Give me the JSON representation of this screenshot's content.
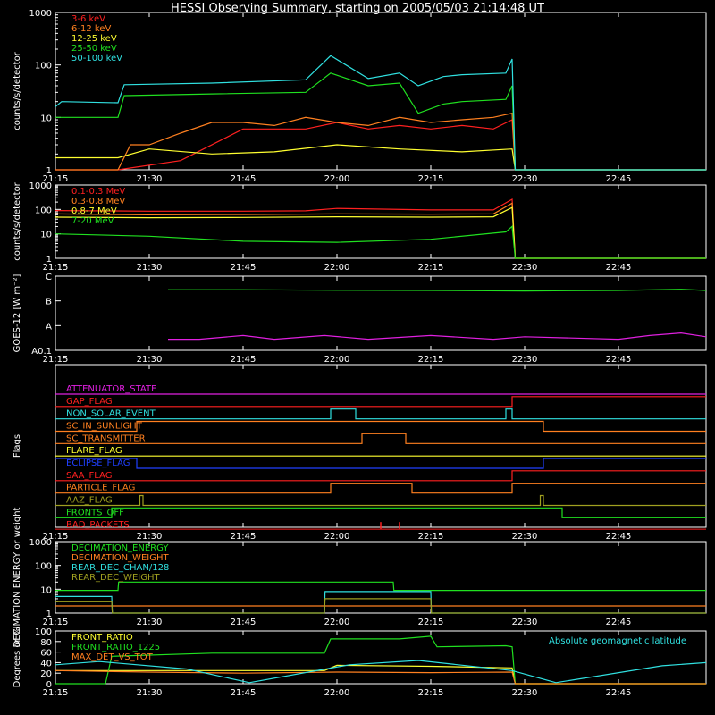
{
  "title": "HESSI Observing Summary, starting on 2005/05/03 21:14:48 UT",
  "time_ticks": [
    "21:15",
    "21:30",
    "21:45",
    "22:00",
    "22:15",
    "22:30",
    "22:45"
  ],
  "colors": {
    "background": "#000000",
    "axis": "#ffffff",
    "red": "#ff2020",
    "orange": "#ff8020",
    "yellow": "#ffff30",
    "green": "#20e020",
    "cyan": "#30e0e0",
    "magenta": "#e020e0",
    "blue": "#2040ff",
    "olive": "#a0a020"
  },
  "chart_data": [
    {
      "id": "counts-low",
      "type": "line",
      "ylabel": "counts/s/detector",
      "yscale": "log",
      "ylim": [
        1,
        1000
      ],
      "yticks": [
        "1",
        "10",
        "100",
        "1000"
      ],
      "x_unit": "UT",
      "series": [
        {
          "name": "3-6 keV",
          "color": "red",
          "x": [
            "21:15",
            "21:25",
            "21:35",
            "21:45",
            "21:55",
            "22:00",
            "22:05",
            "22:10",
            "22:15",
            "22:20",
            "22:25",
            "22:28",
            "22:28.5",
            "22:59"
          ],
          "values": [
            1,
            1,
            1.5,
            6,
            6,
            8,
            6,
            7,
            6,
            7,
            6,
            9,
            1,
            1
          ]
        },
        {
          "name": "6-12 keV",
          "color": "orange",
          "x": [
            "21:15",
            "21:25",
            "21:27",
            "21:30",
            "21:35",
            "21:40",
            "21:45",
            "21:50",
            "21:55",
            "22:00",
            "22:05",
            "22:10",
            "22:15",
            "22:20",
            "22:25",
            "22:28",
            "22:28.5",
            "22:59"
          ],
          "values": [
            1,
            1,
            3,
            3,
            5,
            8,
            8,
            7,
            10,
            8,
            7,
            10,
            8,
            9,
            10,
            12,
            1,
            1
          ]
        },
        {
          "name": "12-25 keV",
          "color": "yellow",
          "x": [
            "21:15",
            "21:25",
            "21:30",
            "21:40",
            "21:50",
            "22:00",
            "22:10",
            "22:20",
            "22:28",
            "22:28.5",
            "22:59"
          ],
          "values": [
            1.7,
            1.7,
            2.5,
            2,
            2.2,
            3,
            2.5,
            2.2,
            2.5,
            1,
            1
          ]
        },
        {
          "name": "25-50 keV",
          "color": "green",
          "x": [
            "21:15",
            "21:25",
            "21:26",
            "21:40",
            "21:55",
            "21:59",
            "22:05",
            "22:10",
            "22:13",
            "22:17",
            "22:20",
            "22:27",
            "22:28",
            "22:28.5",
            "22:59"
          ],
          "values": [
            10,
            10,
            26,
            28,
            30,
            70,
            40,
            45,
            12,
            18,
            20,
            22,
            40,
            1,
            1
          ]
        },
        {
          "name": "50-100 keV",
          "color": "cyan",
          "x": [
            "21:15",
            "21:16",
            "21:25",
            "21:26",
            "21:40",
            "21:55",
            "21:59",
            "22:05",
            "22:10",
            "22:13",
            "22:17",
            "22:20",
            "22:27",
            "22:28",
            "22:28.5",
            "22:59"
          ],
          "values": [
            16,
            20,
            19,
            42,
            45,
            52,
            150,
            55,
            70,
            40,
            60,
            65,
            70,
            130,
            1,
            1
          ]
        }
      ]
    },
    {
      "id": "counts-high",
      "type": "line",
      "ylabel": "counts/s/detector",
      "yscale": "log",
      "ylim": [
        1,
        1000
      ],
      "yticks": [
        "1",
        "10",
        "100",
        "1000"
      ],
      "series": [
        {
          "name": "0.1-0.3 MeV",
          "color": "red",
          "x": [
            "21:15",
            "21:30",
            "21:45",
            "21:55",
            "22:00",
            "22:15",
            "22:25",
            "22:28",
            "22:28.5",
            "22:59"
          ],
          "values": [
            90,
            85,
            85,
            88,
            110,
            95,
            95,
            260,
            1,
            1
          ]
        },
        {
          "name": "0.3-0.8 MeV",
          "color": "orange",
          "x": [
            "21:15",
            "21:30",
            "21:45",
            "22:00",
            "22:15",
            "22:25",
            "22:28",
            "22:28.5",
            "22:59"
          ],
          "values": [
            65,
            60,
            62,
            65,
            64,
            65,
            180,
            1,
            1
          ]
        },
        {
          "name": "0.8-7 MeV",
          "color": "yellow",
          "x": [
            "21:15",
            "21:30",
            "21:45",
            "22:00",
            "22:15",
            "22:25",
            "22:28",
            "22:28.5",
            "22:59"
          ],
          "values": [
            48,
            46,
            47,
            50,
            48,
            50,
            120,
            1,
            1
          ]
        },
        {
          "name": "7-20 MeV",
          "color": "green",
          "x": [
            "21:15",
            "21:30",
            "21:45",
            "22:00",
            "22:15",
            "22:27",
            "22:28",
            "22:28.5",
            "22:59"
          ],
          "values": [
            10,
            8,
            5,
            4.5,
            6,
            12,
            20,
            1,
            1
          ]
        }
      ]
    },
    {
      "id": "goes",
      "type": "line",
      "ylabel": "GOES-12 [W m⁻²]",
      "ylim": [
        0,
        3
      ],
      "yticks": [
        "A0.1",
        "A",
        "B",
        "C"
      ],
      "series": [
        {
          "color": "green",
          "x": [
            "21:33",
            "21:45",
            "22:00",
            "22:15",
            "22:30",
            "22:45",
            "22:55",
            "22:59"
          ],
          "values": [
            2.45,
            2.45,
            2.43,
            2.42,
            2.4,
            2.42,
            2.47,
            2.42
          ]
        },
        {
          "color": "magenta",
          "x": [
            "21:33",
            "21:38",
            "21:45",
            "21:50",
            "21:58",
            "22:05",
            "22:15",
            "22:25",
            "22:30",
            "22:45",
            "22:50",
            "22:55",
            "22:59"
          ],
          "values": [
            0.45,
            0.45,
            0.6,
            0.45,
            0.6,
            0.45,
            0.6,
            0.45,
            0.55,
            0.45,
            0.6,
            0.7,
            0.55
          ]
        }
      ]
    },
    {
      "id": "flags",
      "type": "line",
      "ylabel": "Flags",
      "flags": [
        {
          "name": "ATTENUATOR_STATE",
          "color": "magenta",
          "transitions": []
        },
        {
          "name": "GAP_FLAG",
          "color": "red",
          "transitions": [
            [
              "22:28",
              1
            ]
          ]
        },
        {
          "name": "NON_SOLAR_EVENT",
          "color": "cyan",
          "transitions": [
            [
              "21:59",
              1
            ],
            [
              "22:03",
              0
            ],
            [
              "22:27",
              1
            ],
            [
              "22:28",
              0
            ]
          ]
        },
        {
          "name": "SC_IN_SUNLIGHT",
          "color": "orange",
          "transitions": [
            [
              "21:28",
              1
            ],
            [
              "22:33",
              0
            ]
          ]
        },
        {
          "name": "SC_TRANSMITTER",
          "color": "orange",
          "transitions": [
            [
              "22:04",
              1
            ],
            [
              "22:11",
              0
            ]
          ]
        },
        {
          "name": "FLARE_FLAG",
          "color": "yellow",
          "transitions": []
        },
        {
          "name": "ECLIPSE_FLAG",
          "color": "blue",
          "transitions": [
            [
              "21:28",
              0
            ],
            [
              "22:33",
              1
            ]
          ]
        },
        {
          "name": "SAA_FLAG",
          "color": "red",
          "transitions": [
            [
              "22:28",
              1
            ]
          ]
        },
        {
          "name": "PARTICLE_FLAG",
          "color": "orange",
          "transitions": [
            [
              "21:59",
              1
            ],
            [
              "22:12",
              0
            ],
            [
              "22:28",
              1
            ]
          ]
        },
        {
          "name": "AAZ_FLAG",
          "color": "olive",
          "transitions": [
            [
              "21:28.5",
              1
            ],
            [
              "21:29",
              0
            ],
            [
              "22:32.5",
              1
            ],
            [
              "22:33",
              0
            ]
          ]
        },
        {
          "name": "FRONTS_OFF",
          "color": "green",
          "transitions": [
            [
              "21:24",
              1
            ],
            [
              "22:36",
              0
            ]
          ]
        },
        {
          "name": "BAD_PACKETS",
          "color": "red",
          "spikes": [
            "22:07",
            "22:10"
          ]
        }
      ]
    },
    {
      "id": "decimation",
      "type": "line",
      "ylabel": "DECIMATION ENERGY or weight",
      "yscale": "log",
      "ylim": [
        1,
        1000
      ],
      "yticks": [
        "1",
        "10",
        "100",
        "1000"
      ],
      "series": [
        {
          "name": "DECIMATION_ENERGY",
          "color": "green",
          "x": [
            "21:15",
            "21:25",
            "21:25.1",
            "22:09",
            "22:09.1",
            "22:59"
          ],
          "values": [
            9,
            9,
            20,
            20,
            9,
            9
          ]
        },
        {
          "name": "DECIMATION_WEIGHT",
          "color": "orange",
          "x": [
            "21:15",
            "22:59"
          ],
          "values": [
            2,
            2
          ]
        },
        {
          "name": "REAR_DEC_CHAN/128",
          "color": "cyan",
          "x": [
            "21:15",
            "21:24",
            "21:24.1",
            "21:58",
            "21:58.1",
            "22:15",
            "22:15.1",
            "22:59"
          ],
          "values": [
            5,
            5,
            1,
            1,
            8,
            8,
            1,
            1
          ]
        },
        {
          "name": "REAR_DEC_WEIGHT",
          "color": "olive",
          "x": [
            "21:15",
            "21:24",
            "21:24.1",
            "21:58",
            "21:58.1",
            "22:15",
            "22:15.1",
            "22:59"
          ],
          "values": [
            3,
            3,
            1,
            1,
            4,
            4,
            1,
            1
          ]
        }
      ]
    },
    {
      "id": "ratios",
      "type": "line",
      "ylabel": "Degrees or %",
      "ylim": [
        0,
        100
      ],
      "yticks": [
        "0",
        "20",
        "40",
        "60",
        "80",
        "100"
      ],
      "annotation": "Absolute geomagnetic latitude",
      "series": [
        {
          "name": "FRONT_RATIO",
          "color": "yellow",
          "x": [
            "21:15",
            "21:58",
            "22:00",
            "22:15",
            "22:28",
            "22:28.5",
            "22:59"
          ],
          "values": [
            25,
            25,
            35,
            33,
            30,
            0,
            0
          ]
        },
        {
          "name": "FRONT_RATIO_1225",
          "color": "green",
          "x": [
            "21:15",
            "21:23",
            "21:24",
            "21:40",
            "21:58",
            "21:59",
            "22:10",
            "22:15",
            "22:16",
            "22:27",
            "22:28",
            "22:28.5",
            "22:59"
          ],
          "values": [
            0,
            0,
            52,
            58,
            58,
            85,
            85,
            90,
            70,
            72,
            70,
            0,
            0
          ]
        },
        {
          "name": "MAX_DET_VS_TOT",
          "color": "orange",
          "x": [
            "21:15",
            "21:30",
            "21:45",
            "22:00",
            "22:15",
            "22:28",
            "22:28.5",
            "22:59"
          ],
          "values": [
            25,
            22,
            20,
            22,
            21,
            22,
            0,
            0
          ]
        },
        {
          "name": "Absolute geomagnetic latitude",
          "color": "cyan",
          "x": [
            "21:15",
            "21:22",
            "21:36",
            "21:46",
            "22:02",
            "22:13",
            "22:28",
            "22:35",
            "22:52",
            "22:59"
          ],
          "values": [
            36,
            42,
            28,
            2,
            36,
            44,
            25,
            2,
            34,
            40
          ]
        }
      ]
    }
  ]
}
